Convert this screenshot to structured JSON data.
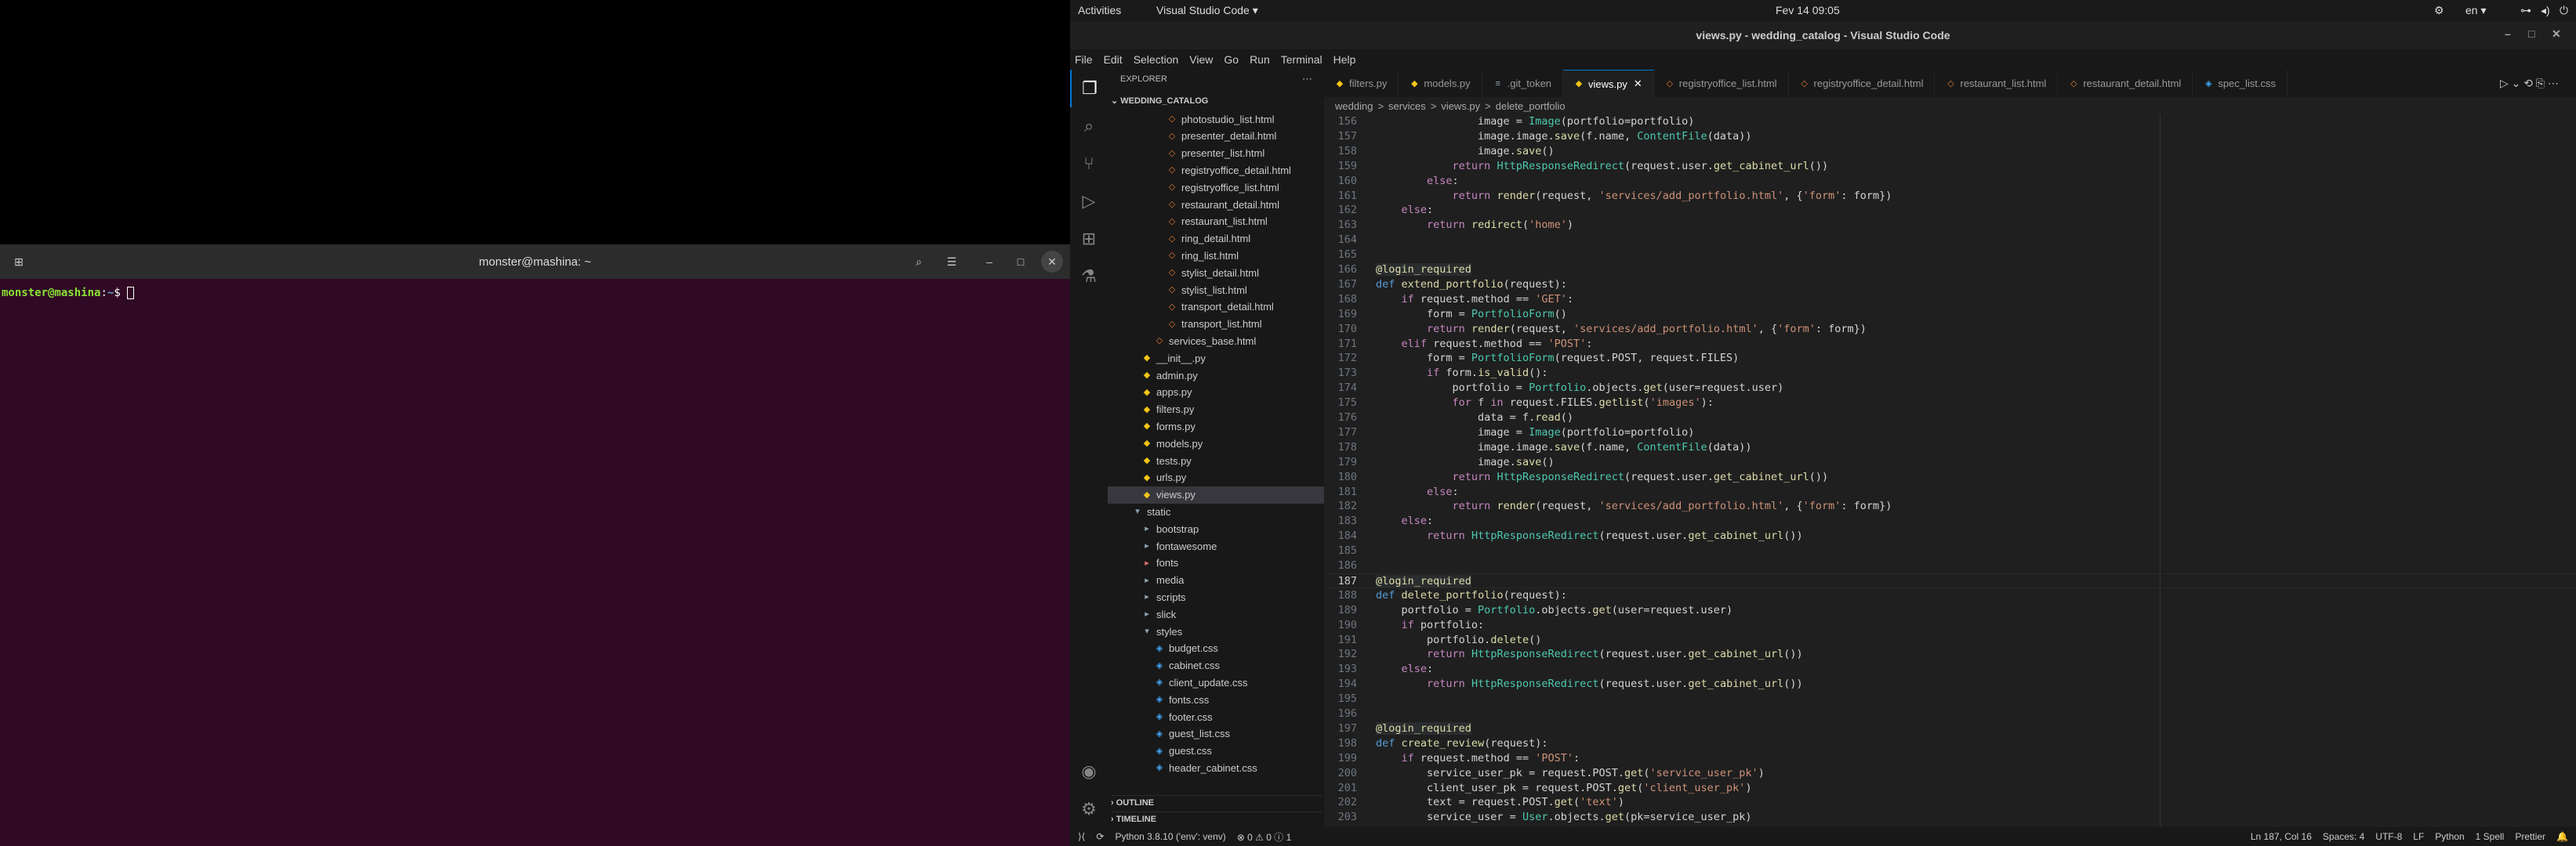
{
  "desktop": {
    "activities": "Activities",
    "app_menu": "Visual Studio Code ▾",
    "clock": "Fev 14  09:05",
    "lang": "en ▾"
  },
  "terminal": {
    "title": "monster@mashina: ~",
    "prompt_user": "monster@mashina",
    "prompt_sep": ":",
    "prompt_path": "~",
    "prompt_symbol": "$"
  },
  "vscode": {
    "title": "views.py - wedding_catalog - Visual Studio Code",
    "menu": [
      "File",
      "Edit",
      "Selection",
      "View",
      "Go",
      "Run",
      "Terminal",
      "Help"
    ],
    "explorer": {
      "header": "EXPLORER",
      "root": "WEDDING_CATALOG",
      "outline": "OUTLINE",
      "timeline": "TIMELINE",
      "items": [
        {
          "name": "photostudio_list.html",
          "type": "html",
          "depth": 3
        },
        {
          "name": "presenter_detail.html",
          "type": "html",
          "depth": 3
        },
        {
          "name": "presenter_list.html",
          "type": "html",
          "depth": 3
        },
        {
          "name": "registryoffice_detail.html",
          "type": "html",
          "depth": 3
        },
        {
          "name": "registryoffice_list.html",
          "type": "html",
          "depth": 3
        },
        {
          "name": "restaurant_detail.html",
          "type": "html",
          "depth": 3
        },
        {
          "name": "restaurant_list.html",
          "type": "html",
          "depth": 3
        },
        {
          "name": "ring_detail.html",
          "type": "html",
          "depth": 3
        },
        {
          "name": "ring_list.html",
          "type": "html",
          "depth": 3
        },
        {
          "name": "stylist_detail.html",
          "type": "html",
          "depth": 3
        },
        {
          "name": "stylist_list.html",
          "type": "html",
          "depth": 3
        },
        {
          "name": "transport_detail.html",
          "type": "html",
          "depth": 3
        },
        {
          "name": "transport_list.html",
          "type": "html",
          "depth": 3
        },
        {
          "name": "services_base.html",
          "type": "html",
          "depth": 2
        },
        {
          "name": "__init__.py",
          "type": "py",
          "depth": 1
        },
        {
          "name": "admin.py",
          "type": "py",
          "depth": 1
        },
        {
          "name": "apps.py",
          "type": "py",
          "depth": 1
        },
        {
          "name": "filters.py",
          "type": "py",
          "depth": 1
        },
        {
          "name": "forms.py",
          "type": "py",
          "depth": 1
        },
        {
          "name": "models.py",
          "type": "py",
          "depth": 1
        },
        {
          "name": "tests.py",
          "type": "py",
          "depth": 1
        },
        {
          "name": "urls.py",
          "type": "py",
          "depth": 1
        },
        {
          "name": "views.py",
          "type": "py",
          "depth": 1,
          "selected": true
        },
        {
          "name": "static",
          "type": "folder-open",
          "depth": 0
        },
        {
          "name": "bootstrap",
          "type": "folder",
          "depth": 1
        },
        {
          "name": "fontawesome",
          "type": "folder",
          "depth": 1
        },
        {
          "name": "fonts",
          "type": "folder-red",
          "depth": 1
        },
        {
          "name": "media",
          "type": "folder",
          "depth": 1
        },
        {
          "name": "scripts",
          "type": "folder",
          "depth": 1
        },
        {
          "name": "slick",
          "type": "folder",
          "depth": 1
        },
        {
          "name": "styles",
          "type": "folder-open",
          "depth": 1
        },
        {
          "name": "budget.css",
          "type": "css",
          "depth": 2
        },
        {
          "name": "cabinet.css",
          "type": "css",
          "depth": 2
        },
        {
          "name": "client_update.css",
          "type": "css",
          "depth": 2
        },
        {
          "name": "fonts.css",
          "type": "css",
          "depth": 2
        },
        {
          "name": "footer.css",
          "type": "css",
          "depth": 2
        },
        {
          "name": "guest_list.css",
          "type": "css",
          "depth": 2
        },
        {
          "name": "guest.css",
          "type": "css",
          "depth": 2
        },
        {
          "name": "header_cabinet.css",
          "type": "css",
          "depth": 2
        }
      ]
    },
    "tabs": [
      {
        "label": "filters.py",
        "type": "py"
      },
      {
        "label": "models.py",
        "type": "py"
      },
      {
        "label": ".git_token",
        "type": "txt"
      },
      {
        "label": "views.py",
        "type": "py",
        "active": true
      },
      {
        "label": "registryoffice_list.html",
        "type": "html"
      },
      {
        "label": "registryoffice_detail.html",
        "type": "html"
      },
      {
        "label": "restaurant_list.html",
        "type": "html"
      },
      {
        "label": "restaurant_detail.html",
        "type": "html"
      },
      {
        "label": "spec_list.css",
        "type": "css"
      }
    ],
    "breadcrumb": [
      "wedding",
      ">",
      "services",
      ">",
      "views.py",
      ">",
      "delete_portfolio"
    ],
    "code": [
      {
        "n": "156",
        "t": "                image = Image(portfolio=portfolio)"
      },
      {
        "n": "157",
        "t": "                image.image.save(f.name, ContentFile(data))"
      },
      {
        "n": "158",
        "t": "                image.save()"
      },
      {
        "n": "159",
        "t": "            return HttpResponseRedirect(request.user.get_cabinet_url())"
      },
      {
        "n": "160",
        "t": "        else:"
      },
      {
        "n": "161",
        "t": "            return render(request, 'services/add_portfolio.html', {'form': form})"
      },
      {
        "n": "162",
        "t": "    else:"
      },
      {
        "n": "163",
        "t": "        return redirect('home')"
      },
      {
        "n": "164",
        "t": ""
      },
      {
        "n": "165",
        "t": ""
      },
      {
        "n": "166",
        "t": "@login_required"
      },
      {
        "n": "167",
        "t": "def extend_portfolio(request):"
      },
      {
        "n": "168",
        "t": "    if request.method == 'GET':"
      },
      {
        "n": "169",
        "t": "        form = PortfolioForm()"
      },
      {
        "n": "170",
        "t": "        return render(request, 'services/add_portfolio.html', {'form': form})"
      },
      {
        "n": "171",
        "t": "    elif request.method == 'POST':"
      },
      {
        "n": "172",
        "t": "        form = PortfolioForm(request.POST, request.FILES)"
      },
      {
        "n": "173",
        "t": "        if form.is_valid():"
      },
      {
        "n": "174",
        "t": "            portfolio = Portfolio.objects.get(user=request.user)"
      },
      {
        "n": "175",
        "t": "            for f in request.FILES.getlist('images'):"
      },
      {
        "n": "176",
        "t": "                data = f.read()"
      },
      {
        "n": "177",
        "t": "                image = Image(portfolio=portfolio)"
      },
      {
        "n": "178",
        "t": "                image.image.save(f.name, ContentFile(data))"
      },
      {
        "n": "179",
        "t": "                image.save()"
      },
      {
        "n": "180",
        "t": "            return HttpResponseRedirect(request.user.get_cabinet_url())"
      },
      {
        "n": "181",
        "t": "        else:"
      },
      {
        "n": "182",
        "t": "            return render(request, 'services/add_portfolio.html', {'form': form})"
      },
      {
        "n": "183",
        "t": "    else:"
      },
      {
        "n": "184",
        "t": "        return HttpResponseRedirect(request.user.get_cabinet_url())"
      },
      {
        "n": "185",
        "t": ""
      },
      {
        "n": "186",
        "t": ""
      },
      {
        "n": "187",
        "t": "@login_required"
      },
      {
        "n": "188",
        "t": "def delete_portfolio(request):"
      },
      {
        "n": "189",
        "t": "    portfolio = Portfolio.objects.get(user=request.user)"
      },
      {
        "n": "190",
        "t": "    if portfolio:"
      },
      {
        "n": "191",
        "t": "        portfolio.delete()"
      },
      {
        "n": "192",
        "t": "        return HttpResponseRedirect(request.user.get_cabinet_url())"
      },
      {
        "n": "193",
        "t": "    else:"
      },
      {
        "n": "194",
        "t": "        return HttpResponseRedirect(request.user.get_cabinet_url())"
      },
      {
        "n": "195",
        "t": ""
      },
      {
        "n": "196",
        "t": ""
      },
      {
        "n": "197",
        "t": "@login_required"
      },
      {
        "n": "198",
        "t": "def create_review(request):"
      },
      {
        "n": "199",
        "t": "    if request.method == 'POST':"
      },
      {
        "n": "200",
        "t": "        service_user_pk = request.POST.get('service_user_pk')"
      },
      {
        "n": "201",
        "t": "        client_user_pk = request.POST.get('client_user_pk')"
      },
      {
        "n": "202",
        "t": "        text = request.POST.get('text')"
      },
      {
        "n": "203",
        "t": "        service_user = User.objects.get(pk=service_user_pk)"
      }
    ],
    "status": {
      "interpreter": "Python 3.8.10 ('env': venv)",
      "problems": "⊗ 0 ⚠ 0 ⓘ 1",
      "position": "Ln 187, Col 16",
      "spaces": "Spaces: 4",
      "encoding": "UTF-8",
      "eol": "LF",
      "language": "Python",
      "spell": "1 Spell",
      "prettier": "Prettier"
    }
  }
}
